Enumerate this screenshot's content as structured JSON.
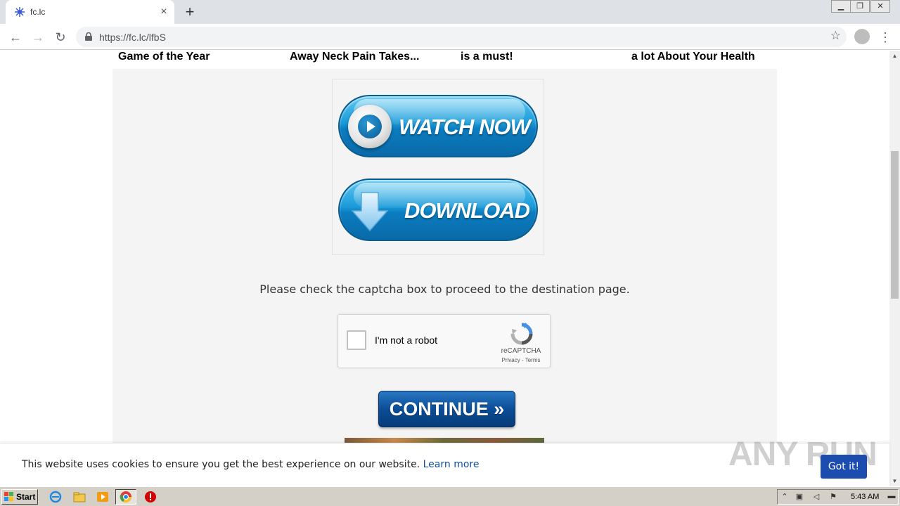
{
  "browser": {
    "tab_title": "fc.lc",
    "url": "https://fc.lc/lfbS",
    "new_tab": "+",
    "close": "×"
  },
  "headlines": [
    "Game of the Year",
    "Away Neck Pain Takes...",
    "is a must!",
    "a lot About Your Health"
  ],
  "buttons": {
    "watch_now": "WATCH NOW",
    "download": "DOWNLOAD",
    "continue": "CONTINUE »"
  },
  "captcha": {
    "instruction": "Please check the captcha box to proceed to the destination page.",
    "checkbox_label": "I'm not a robot",
    "brand": "reCAPTCHA",
    "terms": "Privacy - Terms"
  },
  "cookie": {
    "text": "This website uses cookies to ensure you get the best experience on our website.",
    "link": "Learn more",
    "button": "Got it!",
    "watermark": "ANY RUN"
  },
  "taskbar": {
    "start": "Start",
    "clock": "5:43 AM"
  },
  "colors": {
    "accent_blue": "#1c4cb0",
    "link": "#0e4fa0",
    "page_bg": "#f4f4f4"
  }
}
